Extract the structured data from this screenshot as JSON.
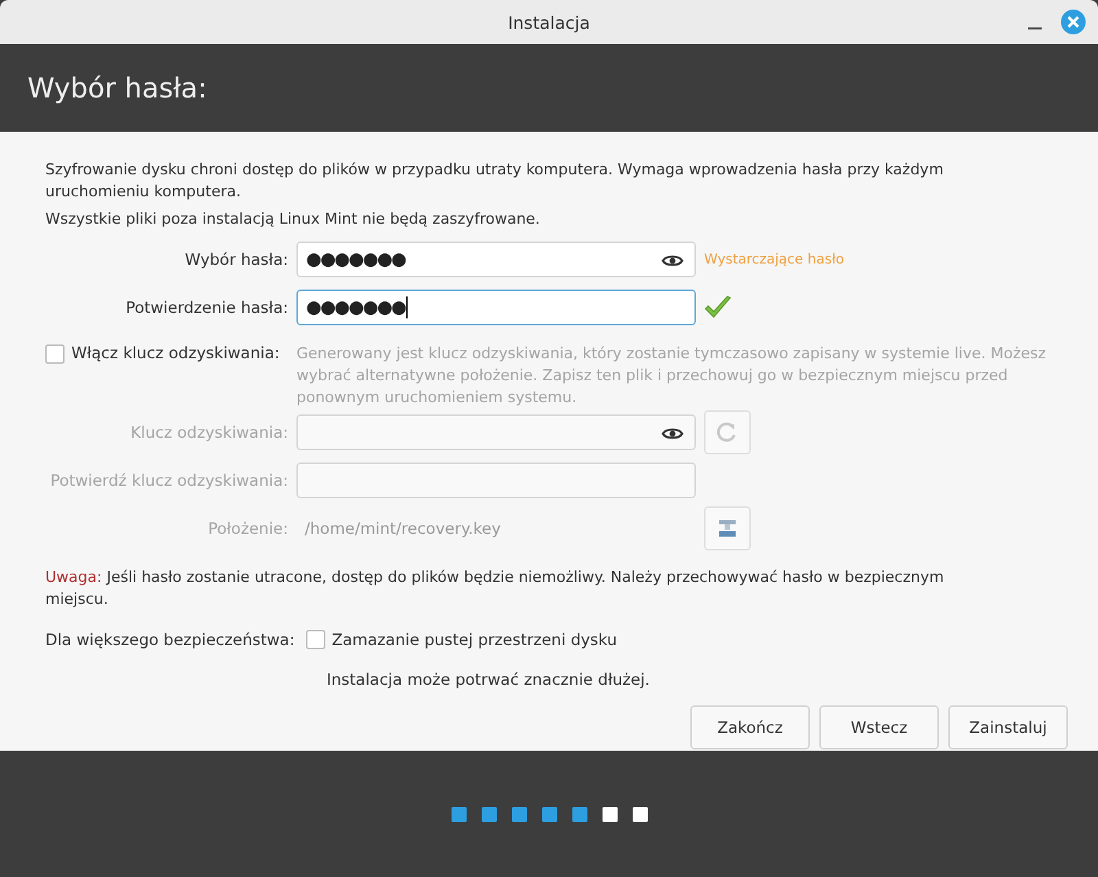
{
  "window": {
    "title": "Instalacja"
  },
  "header": {
    "title": "Wybór hasła:"
  },
  "intro": [
    "Szyfrowanie dysku chroni dostęp do plików w przypadku utraty komputera. Wymaga wprowadzenia hasła przy każdym uruchomieniu komputera.",
    "Wszystkie pliki poza instalacją Linux Mint nie będą zaszyfrowane."
  ],
  "password_fields": [
    {
      "kind": "password",
      "label": "Wybór hasła:",
      "value": "●●●●●●●",
      "focused": false,
      "status": "Wystarczające hasło"
    },
    {
      "kind": "confirm",
      "label": "Potwierdzenie hasła:",
      "value": "●●●●●●●",
      "focused": true
    }
  ],
  "recovery": {
    "label": "Włącz klucz odzyskiwania:",
    "checked": false,
    "description": "Generowany jest klucz odzyskiwania, który zostanie tymczasowo zapisany w systemie live. Możesz wybrać alternatywne położenie. Zapisz ten plik i przechowuj go w bezpiecznym miejscu przed ponownym uruchomieniem systemu.",
    "rows": [
      {
        "kind": "key",
        "label": "Klucz odzyskiwania:"
      },
      {
        "kind": "confirm",
        "label": "Potwierdź klucz odzyskiwania:"
      },
      {
        "kind": "path",
        "label": "Położenie:",
        "value": "/home/mint/recovery.key"
      }
    ]
  },
  "warning": {
    "prefix": "Uwaga:",
    "text": " Jeśli hasło zostanie utracone, dostęp do plików będzie niemożliwy. Należy przechowywać hasło w bezpiecznym miejscu."
  },
  "security": {
    "label": "Dla większego bezpieczeństwa:",
    "option": "Zamazanie pustej przestrzeni dysku",
    "checked": false,
    "note": "Instalacja może potrwać znacznie dłużej."
  },
  "buttons": [
    "Zakończ",
    "Wstecz",
    "Zainstaluj"
  ],
  "steps": [
    {
      "done": true
    },
    {
      "done": true
    },
    {
      "done": true
    },
    {
      "done": true
    },
    {
      "done": true
    },
    {
      "done": false
    },
    {
      "done": false
    }
  ]
}
